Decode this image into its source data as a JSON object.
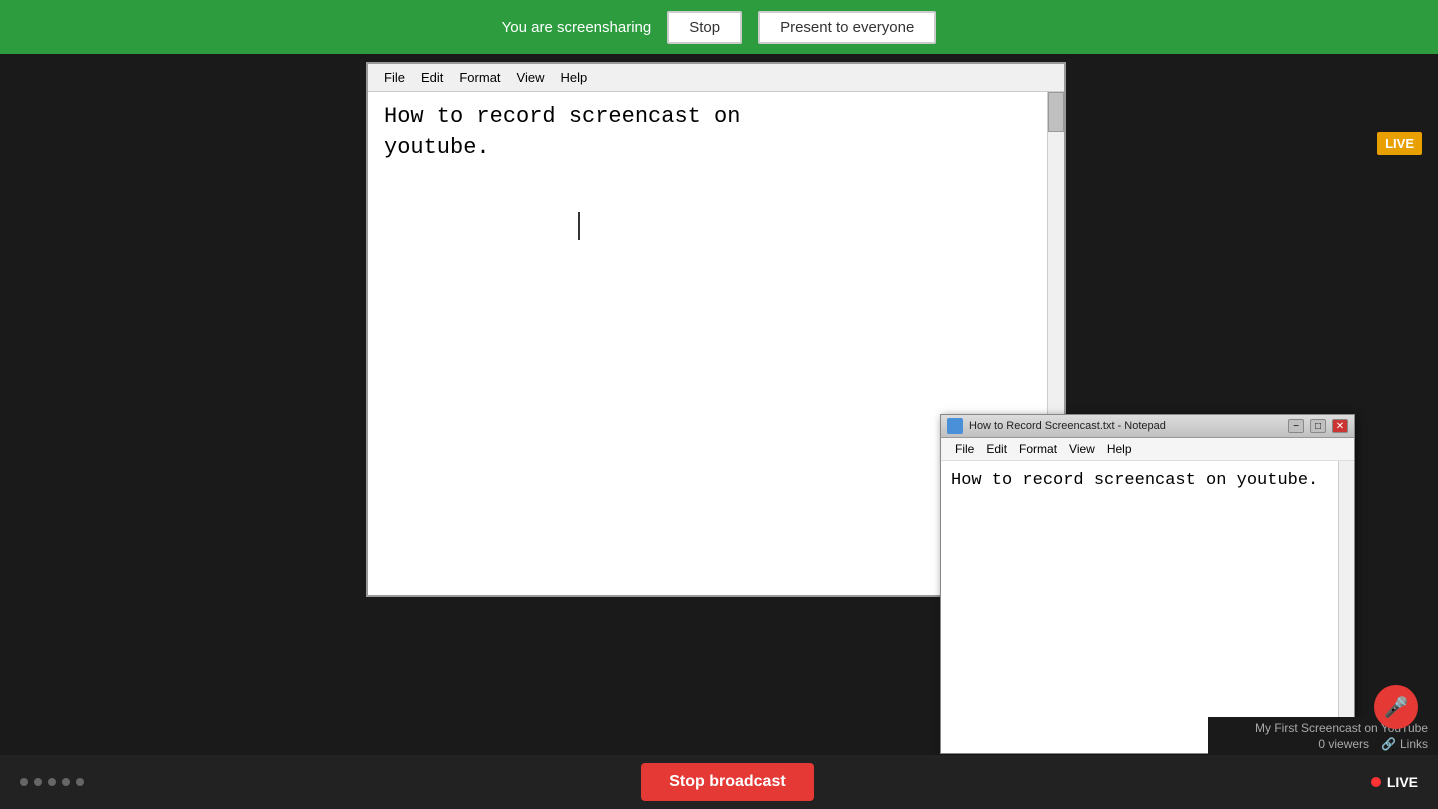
{
  "screenshare_bar": {
    "message": "You are screensharing",
    "stop_label": "Stop",
    "present_label": "Present to everyone"
  },
  "live_badge": "LIVE",
  "notepad_large": {
    "menu_items": [
      "File",
      "Edit",
      "Format",
      "View",
      "Help"
    ],
    "content": "How to record screencast on\nyoutube."
  },
  "notepad_small": {
    "title": "How to Record Screencast.txt - Notepad",
    "menu_items": [
      "File",
      "Edit",
      "Format",
      "View",
      "Help"
    ],
    "content": "How to record screencast on\nyoutube.",
    "window_controls": {
      "minimize": "−",
      "maximize": "□",
      "close": "✕"
    }
  },
  "bottom_bar": {
    "stop_broadcast_label": "Stop broadcast",
    "live_label": "LIVE",
    "dots": [
      "",
      "",
      "",
      "",
      ""
    ]
  },
  "youtube_info": {
    "title": "My First Screencast on YouTube",
    "viewers": "0 viewers",
    "links_label": "Links"
  }
}
